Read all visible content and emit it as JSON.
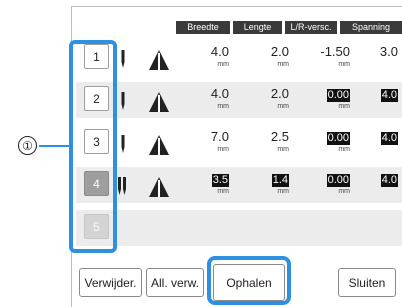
{
  "columns": {
    "width": "Breedte",
    "length": "Lengte",
    "lr_shift": "L/R-versc.",
    "tension": "Spanning"
  },
  "rows": [
    {
      "slot": "1",
      "width": "4.0",
      "length": "2.0",
      "lr_shift": "-1.50",
      "tension": "3.0",
      "state": "normal"
    },
    {
      "slot": "2",
      "width": "4.0",
      "length": "2.0",
      "lr_shift": "0.00",
      "tension": "4.0",
      "state": "normal"
    },
    {
      "slot": "3",
      "width": "7.0",
      "length": "2.5",
      "lr_shift": "0.00",
      "tension": "4.0",
      "state": "normal"
    },
    {
      "slot": "4",
      "width": "3.5",
      "length": "1.4",
      "lr_shift": "0.00",
      "tension": "4.0",
      "state": "active"
    },
    {
      "slot": "5",
      "state": "disabled"
    }
  ],
  "unit": "mm",
  "callout": "①",
  "buttons": {
    "delete": "Verwijder.",
    "delete_all": "All. verw.",
    "retrieve": "Ophalen",
    "close": "Sluiten"
  },
  "colors": {
    "highlight": "#2f8fe0",
    "header": "#3a3a3a"
  }
}
